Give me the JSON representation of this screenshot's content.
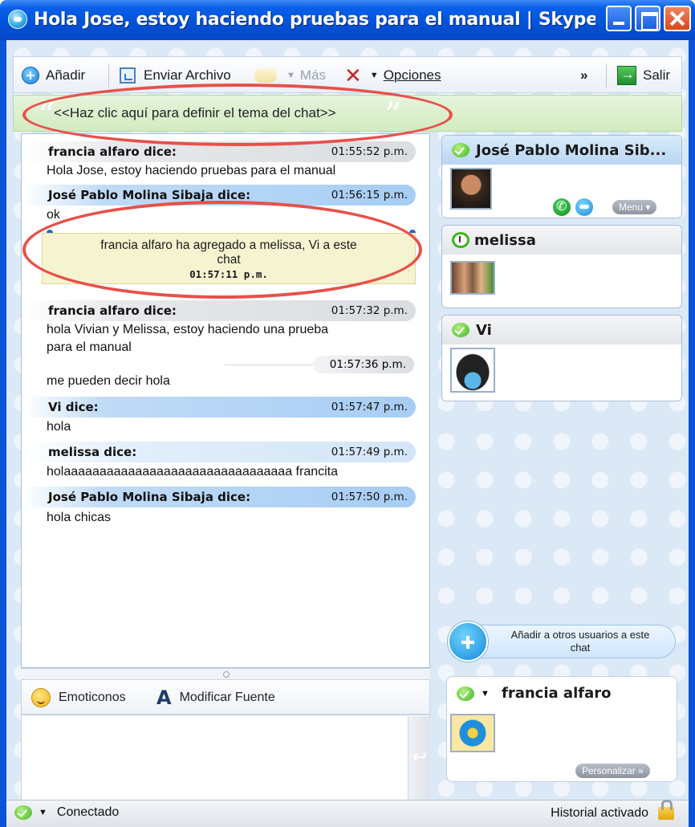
{
  "window": {
    "title": "Hola Jose, estoy haciendo pruebas para el manual | Skype™ C..."
  },
  "toolbar": {
    "add": "Añadir",
    "send_file": "Enviar Archivo",
    "more": "Más",
    "options": "Opciones",
    "overflow": "»",
    "exit": "Salir"
  },
  "topic": {
    "text": "<<Haz clic aquí para definir el tema del chat>>"
  },
  "messages": [
    {
      "sender": "francia alfaro dice:",
      "time": "01:55:52 p.m.",
      "text": "Hola Jose, estoy haciendo pruebas para el manual"
    },
    {
      "sender": "José Pablo Molina Sibaja dice:",
      "time": "01:56:15 p.m.",
      "text": "ok"
    },
    {
      "sender": "francia alfaro dice:",
      "time": "01:57:32 p.m.",
      "text": "hola Vivian y Melissa, estoy haciendo una prueba",
      "text2": "para el manual"
    },
    {
      "time": "01:57:36 p.m.",
      "text": "me pueden decir hola"
    },
    {
      "sender": "Vi dice:",
      "time": "01:57:47 p.m.",
      "text": "hola"
    },
    {
      "sender": "melissa dice:",
      "time": "01:57:49 p.m.",
      "text": "holaaaaaaaaaaaaaaaaaaaaaaaaaaaaaaaa francita"
    },
    {
      "sender": "José Pablo Molina Sibaja dice:",
      "time": "01:57:50 p.m.",
      "text": "hola chicas"
    }
  ],
  "notice": {
    "line1": "francia alfaro ha agregado a melissa, Vi a este",
    "line2": "chat",
    "time": "01:57:11 p.m."
  },
  "format_bar": {
    "emoticons": "Emoticonos",
    "font": "Modificar Fuente",
    "font_glyph": "A"
  },
  "input": {
    "value": ""
  },
  "participants": [
    {
      "name": "José Pablo Molina Sib...",
      "menu": "Menu ▾"
    },
    {
      "name": "melissa"
    },
    {
      "name": "Vi"
    }
  ],
  "add_users": {
    "line1": "Añadir a otros usuarios a este",
    "line2": "chat"
  },
  "me": {
    "name": "francia alfaro",
    "customize": "Personalizar »"
  },
  "status": {
    "online": "Conectado",
    "history": "Historial activado"
  }
}
